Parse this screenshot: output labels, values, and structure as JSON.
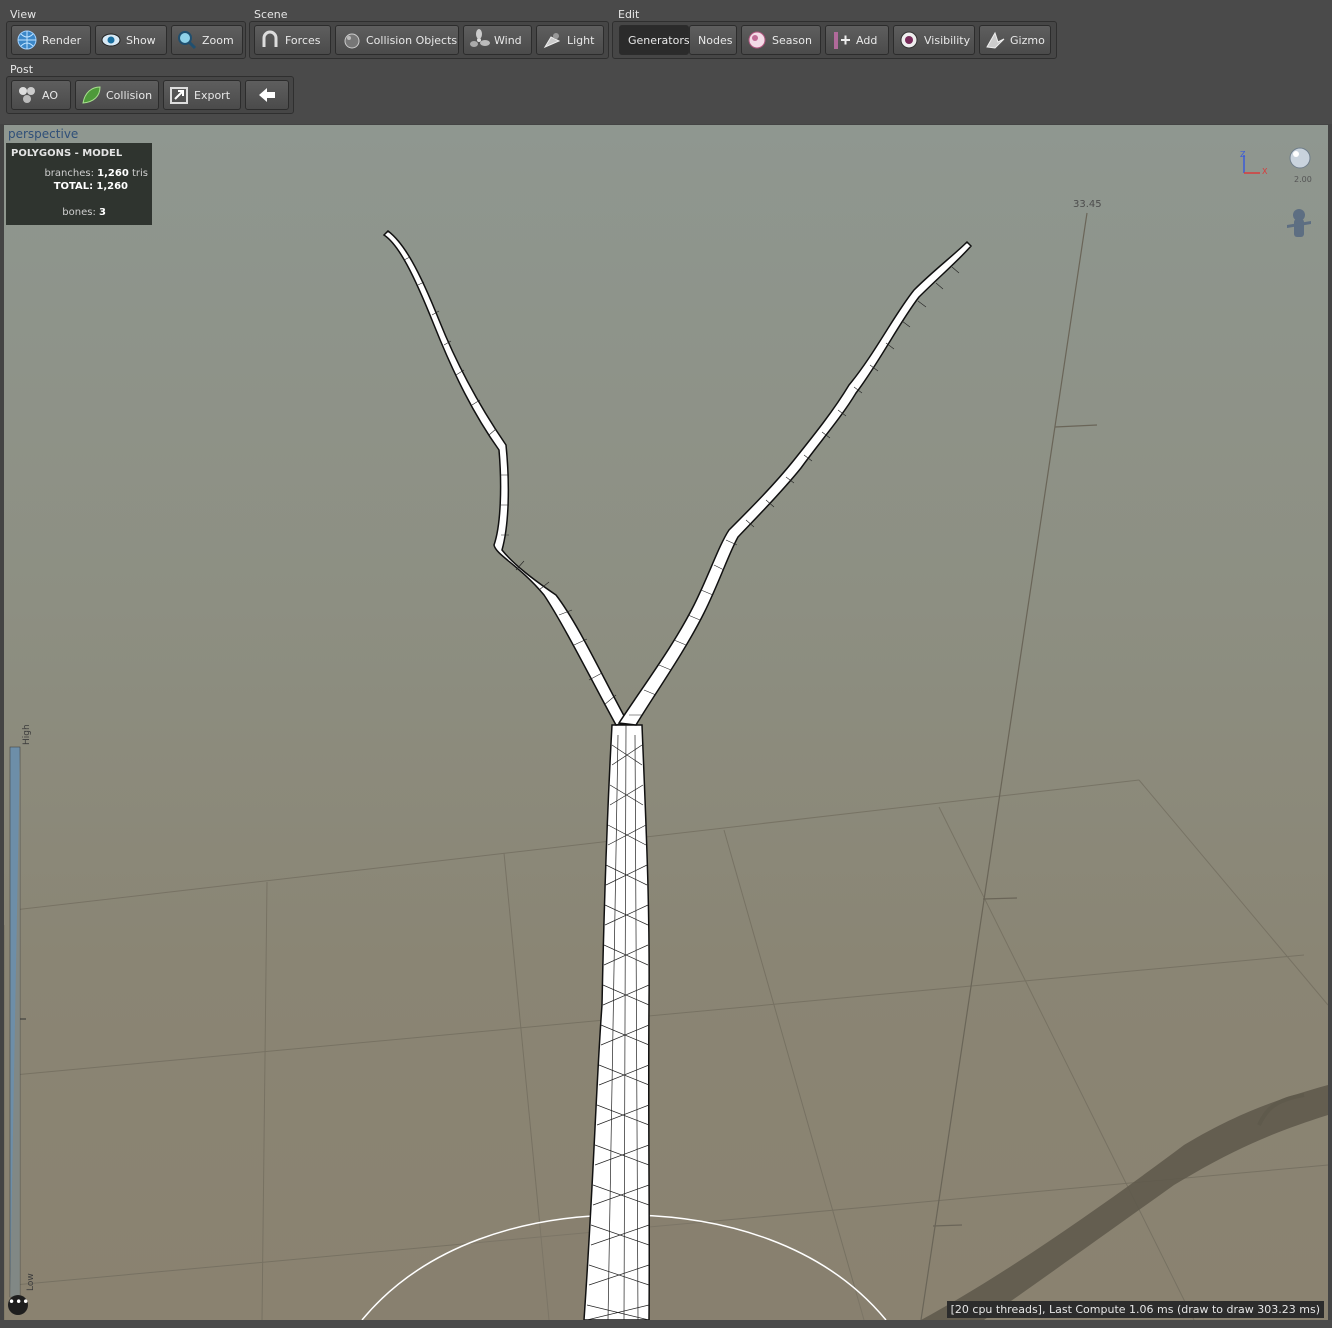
{
  "toolbar": {
    "groups": [
      {
        "label": "View",
        "buttons": [
          "Render",
          "Show",
          "Zoom"
        ]
      },
      {
        "label": "Scene",
        "buttons": [
          "Forces",
          "Collision Objects",
          "Wind",
          "Light"
        ]
      },
      {
        "label": "Edit",
        "buttons": [
          "Generators",
          "Nodes",
          "Season",
          "Add",
          "Visibility",
          "Gizmo"
        ]
      },
      {
        "label": "Post",
        "buttons": [
          "AO",
          "Collision",
          "Export"
        ]
      }
    ]
  },
  "viewport": {
    "view_name": "perspective",
    "polygons_panel": {
      "title": "POLYGONS - MODEL",
      "branches_key": "branches:",
      "branches_value": "1,260",
      "branches_unit": "tris",
      "total_key": "TOTAL:",
      "total_value": "1,260",
      "bones_key": "bones:",
      "bones_value": "3"
    },
    "ruler_value": "33.45",
    "light_value": "2.00",
    "axis_z": "Z",
    "axis_x": "X",
    "lod_high": "High",
    "lod_low": "Low",
    "more_button": "•••",
    "status": "[20 cpu threads], Last Compute 1.06 ms (draw to draw 303.23 ms)"
  },
  "colors": {
    "toolbar_bg": "#4a4a4a",
    "active_tab": "#2b2b2b",
    "viewport_top": "#8f9790",
    "viewport_bottom": "#8a8270",
    "tree_fill": "#ffffff",
    "wire": "#111111"
  },
  "icons": [
    "globe-icon",
    "eye-icon",
    "magnifier-icon",
    "magnet-icon",
    "collision-sphere-icon",
    "fan-icon",
    "spotlight-icon",
    "season-icon",
    "add-node-icon",
    "visibility-eye-icon",
    "gizmo-icon",
    "ao-spheres-icon",
    "collision-leaf-icon",
    "export-icon",
    "back-arrow-icon"
  ]
}
